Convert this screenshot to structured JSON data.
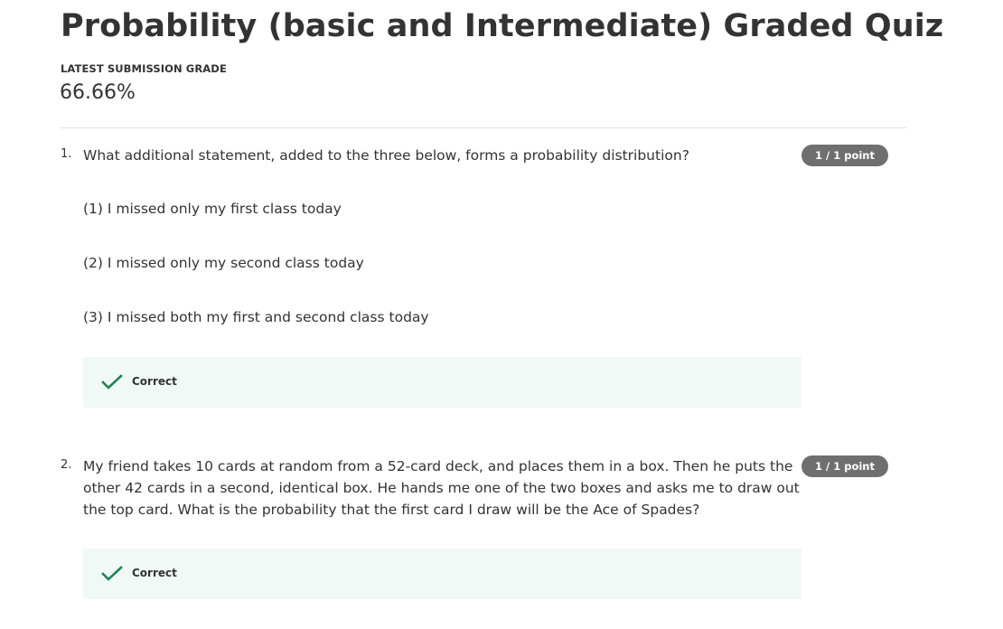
{
  "quiz": {
    "title": "Probability (basic and Intermediate) Graded Quiz",
    "grade_label": "LATEST SUBMISSION GRADE",
    "grade_value": "66.66%"
  },
  "questions": [
    {
      "number": "1.",
      "text": "What additional statement, added to the three below, forms a probability distribution?",
      "points": "1 / 1 point",
      "statements": [
        "(1) I missed only my first class today",
        "(2) I missed only my second class today",
        "(3) I missed both my first and second class today"
      ],
      "feedback": "Correct",
      "feedback_icon": "check-icon"
    },
    {
      "number": "2.",
      "text": "My friend takes 10 cards at random from a 52-card deck, and places them in a box. Then he puts the other 42 cards in a second, identical box. He hands me one of the two boxes and asks me to draw out the top card. What is the probability that the first card I draw will be the Ace of Spades?",
      "points": "1 / 1 point",
      "feedback": "Correct",
      "feedback_icon": "check-icon"
    }
  ],
  "colors": {
    "correct_green": "#1f8354",
    "feedback_bg": "#f1f9f6",
    "badge_bg": "#6f6f6f",
    "text": "#333333"
  }
}
